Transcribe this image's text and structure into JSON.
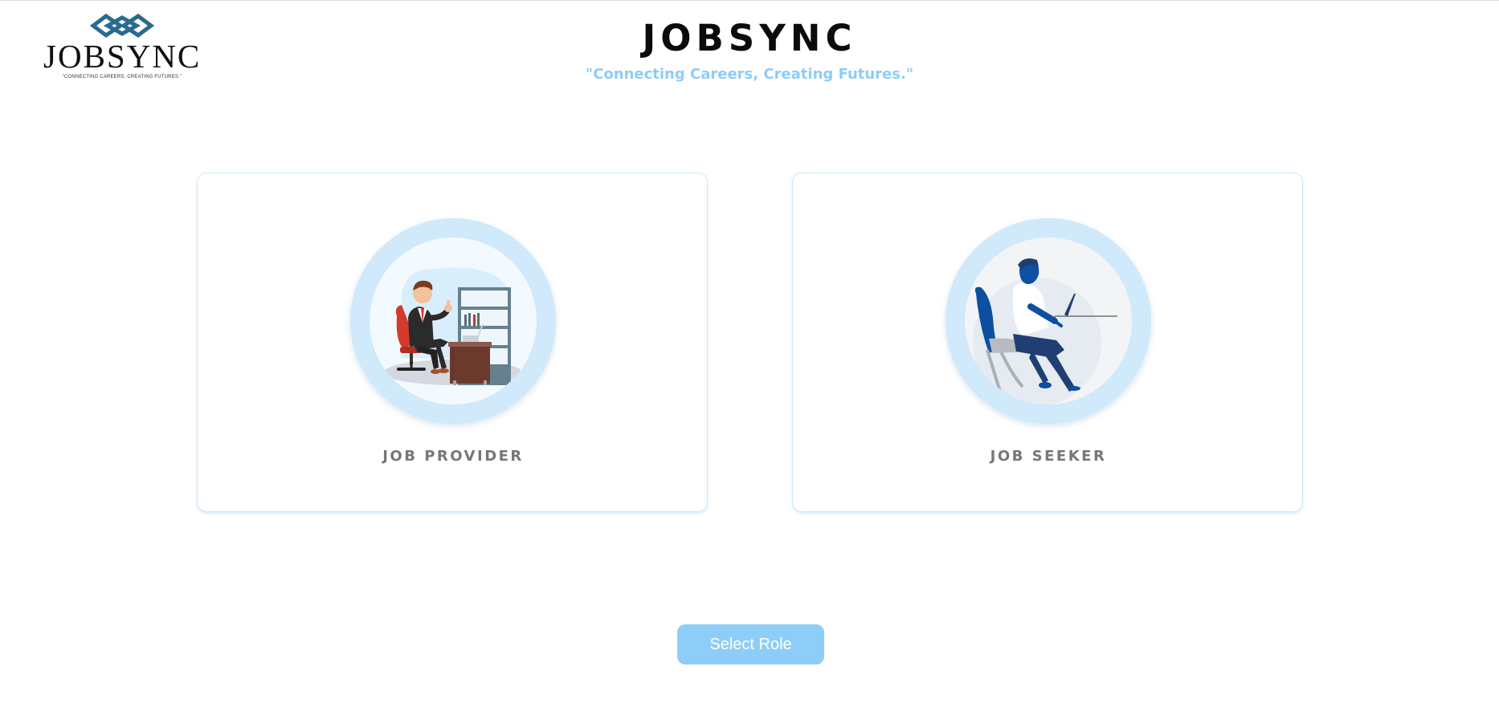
{
  "logo": {
    "wordmark": "JOBSYNC",
    "tagline": "\"CONNECTING CAREERS, CREATING FUTURES.\"",
    "icon": "interlocking-links-logo-icon",
    "color": "#2a6a8f"
  },
  "header": {
    "title": "JOBSYNC",
    "subtitle": "\"Connecting Careers, Creating Futures.\""
  },
  "roles": [
    {
      "label": "JOB PROVIDER",
      "icon": "businessman-at-desk-illustration"
    },
    {
      "label": "JOB SEEKER",
      "icon": "person-on-laptop-illustration"
    }
  ],
  "actions": {
    "select_role_label": "Select Role"
  },
  "colors": {
    "accent": "#8ecdf7",
    "ring": "#d0e9fb",
    "card_border": "#cde9fb",
    "label_gray": "#777777"
  }
}
